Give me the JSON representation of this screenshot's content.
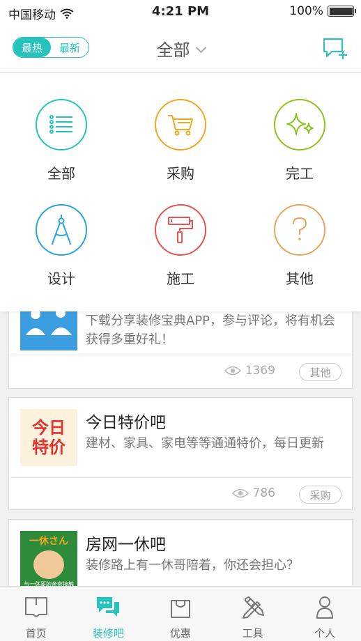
{
  "status_bar": {
    "carrier": "中国移动",
    "time": "4:21 PM",
    "battery": "100%"
  },
  "navbar": {
    "toggle": {
      "active": "最热",
      "inactive": "最新"
    },
    "title": "全部"
  },
  "categories": [
    {
      "label": "全部",
      "color": "#25c3bb",
      "icon": "list-icon"
    },
    {
      "label": "采购",
      "color": "#f5a623",
      "icon": "cart-icon"
    },
    {
      "label": "完工",
      "color": "#8dc21f",
      "icon": "sparkle-icon"
    },
    {
      "label": "设计",
      "color": "#29a3e0",
      "icon": "compass-icon"
    },
    {
      "label": "施工",
      "color": "#e8534f",
      "icon": "paint-roller-icon"
    },
    {
      "label": "其他",
      "color": "#e8a55a",
      "icon": "question-icon"
    }
  ],
  "posts": [
    {
      "title": "",
      "desc": "下载分享装修宝典APP，参与评论，将有机会获得多重好礼！",
      "views": "1369",
      "tag": "其他"
    },
    {
      "title": "今日特价吧",
      "desc": "建材、家具、家电等等通通特价，每日更新",
      "views": "786",
      "tag": "采购",
      "thumb_text": [
        "今日",
        "特价"
      ]
    },
    {
      "title": "房网一休吧",
      "desc": "装修路上有一休哥陪着，你还会担心？",
      "thumb_text": [
        "一休さん",
        "与一休哥的亲密接触"
      ]
    }
  ],
  "tabbar": [
    {
      "label": "首页",
      "icon": "book-icon",
      "active": false
    },
    {
      "label": "装修吧",
      "icon": "chat-bubbles-icon",
      "active": true
    },
    {
      "label": "优惠",
      "icon": "shopping-bag-icon",
      "active": false
    },
    {
      "label": "工具",
      "icon": "tools-icon",
      "active": false
    },
    {
      "label": "个人",
      "icon": "person-icon",
      "active": false
    }
  ],
  "colors": {
    "accent": "#25c3bb"
  }
}
